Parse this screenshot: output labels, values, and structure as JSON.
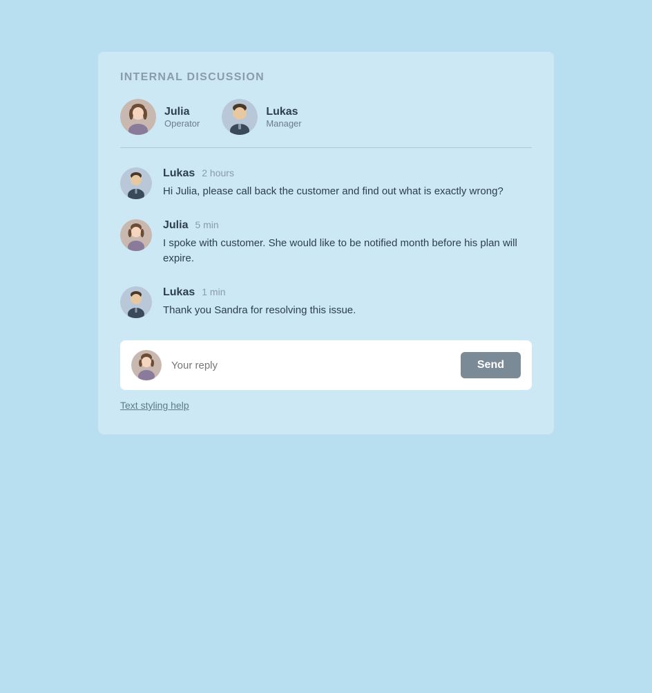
{
  "panel": {
    "title": "INTERNAL DISCUSSION"
  },
  "participants": [
    {
      "id": "julia",
      "name": "Julia",
      "role": "Operator"
    },
    {
      "id": "lukas",
      "name": "Lukas",
      "role": "Manager"
    }
  ],
  "messages": [
    {
      "id": "msg1",
      "author": "Lukas",
      "time": "2 hours",
      "text": "Hi Julia, please call back the customer and find out what is exactly wrong?",
      "avatar": "lukas"
    },
    {
      "id": "msg2",
      "author": "Julia",
      "time": "5 min",
      "text": "I spoke with customer. She would like to be notified month before his plan will expire.",
      "avatar": "julia"
    },
    {
      "id": "msg3",
      "author": "Lukas",
      "time": "1 min",
      "text": "Thank you Sandra for resolving this issue.",
      "avatar": "lukas"
    }
  ],
  "reply_box": {
    "placeholder": "Your reply",
    "send_button_label": "Send",
    "avatar": "julia"
  },
  "text_styling_link": "Text styling help"
}
